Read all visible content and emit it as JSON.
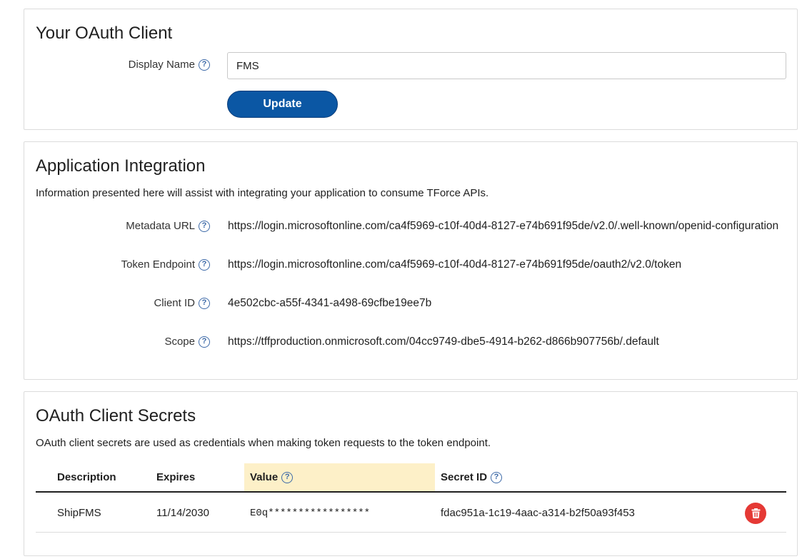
{
  "oauth_client": {
    "title": "Your OAuth Client",
    "display_name_label": "Display Name",
    "display_name_value": "FMS",
    "update_label": "Update"
  },
  "integration": {
    "title": "Application Integration",
    "description": "Information presented here will assist with integrating your application to consume TForce APIs.",
    "fields": [
      {
        "label": "Metadata URL",
        "value": "https://login.microsoftonline.com/ca4f5969-c10f-40d4-8127-e74b691f95de/v2.0/.well-known/openid-configuration"
      },
      {
        "label": "Token Endpoint",
        "value": "https://login.microsoftonline.com/ca4f5969-c10f-40d4-8127-e74b691f95de/oauth2/v2.0/token"
      },
      {
        "label": "Client ID",
        "value": "4e502cbc-a55f-4341-a498-69cfbe19ee7b"
      },
      {
        "label": "Scope",
        "value": "https://tffproduction.onmicrosoft.com/04cc9749-dbe5-4914-b262-d866b907756b/.default"
      }
    ]
  },
  "secrets": {
    "title": "OAuth Client Secrets",
    "description": "OAuth client secrets are used as credentials when making token requests to the token endpoint.",
    "columns": {
      "description": "Description",
      "expires": "Expires",
      "value": "Value",
      "secret_id": "Secret ID"
    },
    "rows": [
      {
        "description": "ShipFMS",
        "expires": "11/14/2030",
        "value": "E0q*****************",
        "secret_id": "fdac951a-1c19-4aac-a314-b2f50a93f453"
      }
    ]
  },
  "colors": {
    "primary_button": "#0b57a4",
    "value_column_highlight": "#fdf0c8",
    "delete_button": "#e53935",
    "help_icon": "#3d6aa8"
  },
  "icons": {
    "help": "question-circle-icon",
    "delete": "trash-icon"
  }
}
